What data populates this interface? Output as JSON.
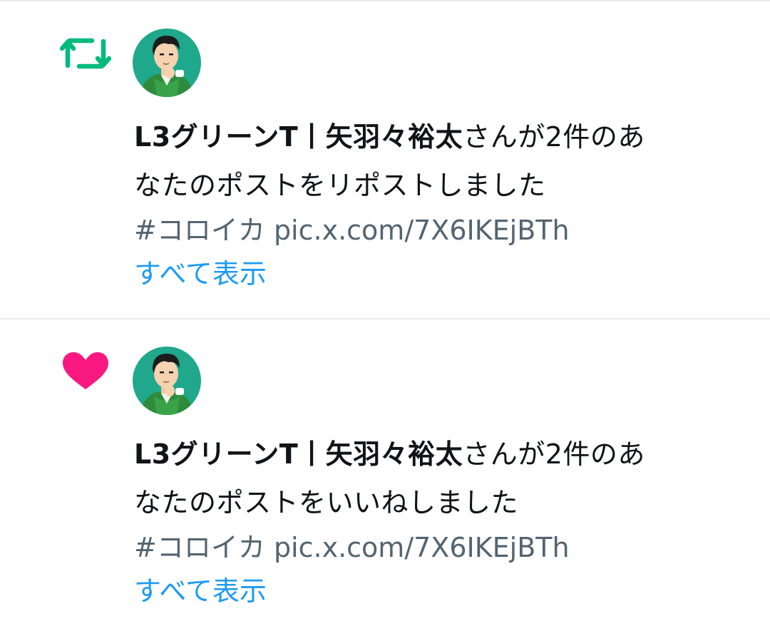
{
  "notifications": [
    {
      "type": "repost",
      "icon": "repost-icon",
      "icon_color": "#00ba7c",
      "user_name": "L3グリーンT丨矢羽々裕太",
      "message_line1": "さんが2件のあ",
      "message_line2": "なたのポストをリポストしました",
      "hashtag": "#コロイカ",
      "link": "pic.x.com/7X6IKEjBTh",
      "show_all": "すべて表示"
    },
    {
      "type": "like",
      "icon": "heart-icon",
      "icon_color": "#f91880",
      "user_name": "L3グリーンT丨矢羽々裕太",
      "message_line1": "さんが2件のあ",
      "message_line2": "なたのポストをいいねしました",
      "hashtag": "#コロイカ",
      "link": "pic.x.com/7X6IKEjBTh",
      "show_all": "すべて表示"
    }
  ],
  "colors": {
    "text": "#0f1419",
    "secondary": "#536471",
    "accent": "#1d9bf0",
    "divider": "#e6e8ea"
  }
}
